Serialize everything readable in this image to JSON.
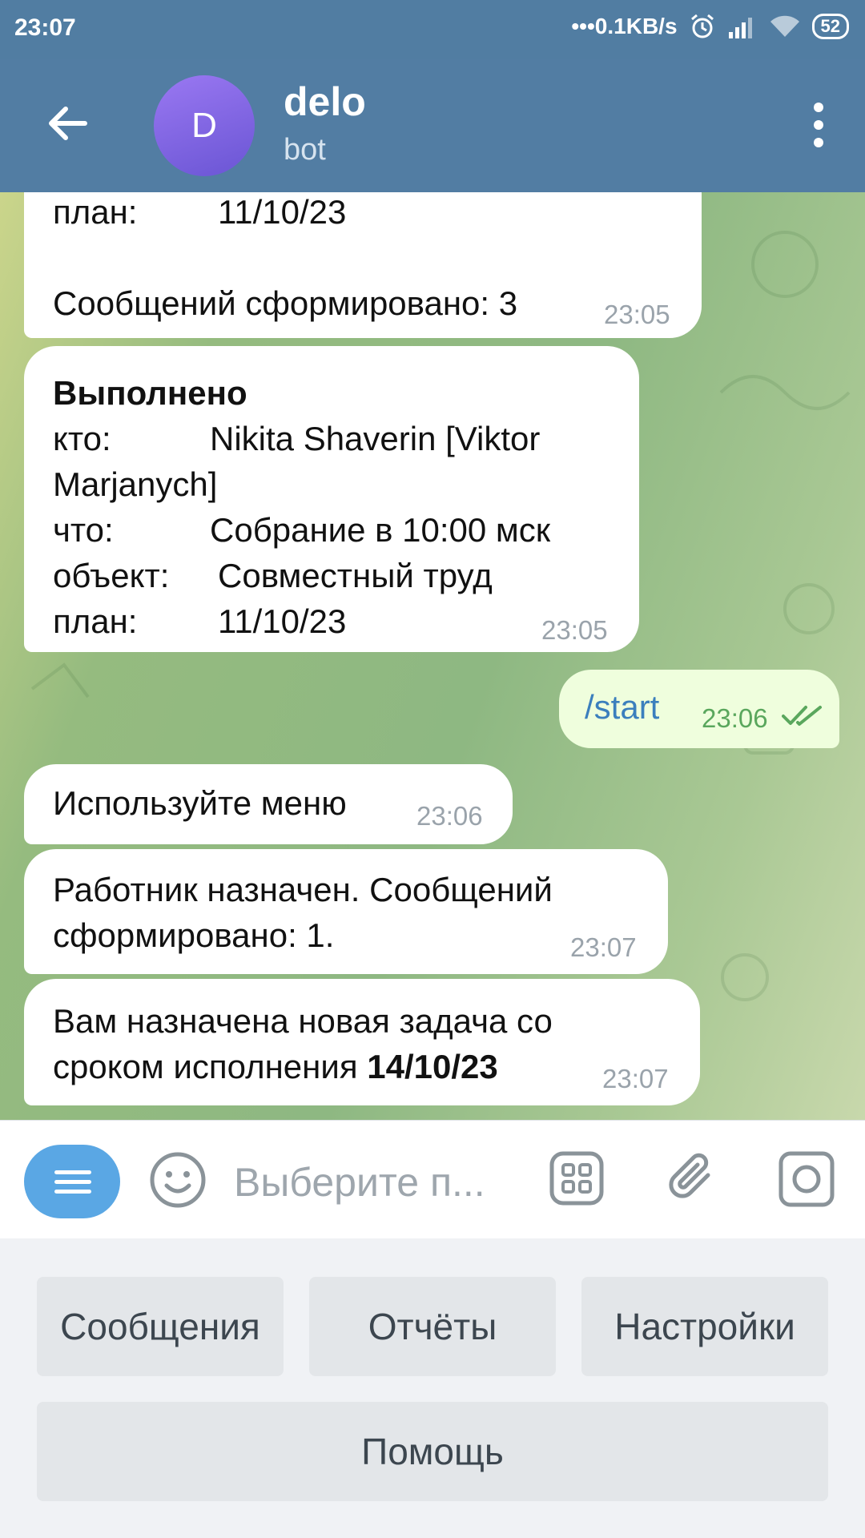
{
  "status_bar": {
    "time": "23:07",
    "net_speed": "0.1KB/s",
    "battery": "52"
  },
  "header": {
    "avatar_letter": "D",
    "title": "delo",
    "subtitle": "bot"
  },
  "messages": [
    {
      "direction": "incoming",
      "lines": [
        {
          "label": "план:",
          "value": "11/10/23"
        },
        {
          "label": "",
          "value": ""
        },
        {
          "label": "Сообщений сформировано: 3",
          "value": ""
        }
      ],
      "time": "23:05"
    },
    {
      "direction": "incoming",
      "heading": "Выполнено",
      "lines": [
        {
          "label": "кто:",
          "value": "Nikita Shaverin [Viktor"
        },
        {
          "label": "Marjanych]",
          "value": ""
        },
        {
          "label": "что:",
          "value": "Собрание в 10:00 мск"
        },
        {
          "label": "объект:",
          "value": "Совместный труд"
        },
        {
          "label": "план:",
          "value": "11/10/23"
        }
      ],
      "time": "23:05"
    },
    {
      "direction": "outgoing",
      "text": "/start",
      "time": "23:06",
      "status": "read"
    },
    {
      "direction": "incoming",
      "text": "Используйте меню",
      "time": "23:06"
    },
    {
      "direction": "incoming",
      "line1": "Работник назначен. Сообщений",
      "line2": "сформировано: 1.",
      "time": "23:07"
    },
    {
      "direction": "incoming",
      "line1": "Вам назначена новая задача со",
      "line2_prefix": "сроком исполнения ",
      "line2_bold": "14/10/23",
      "time": "23:07"
    }
  ],
  "input": {
    "placeholder": "Выберите п..."
  },
  "keyboard": {
    "buttons": [
      "Сообщения",
      "Отчёты",
      "Настройки",
      "Помощь"
    ]
  },
  "colors": {
    "header": "#527da3",
    "menu_button": "#5aa7e4",
    "outgoing_bubble": "#effedd",
    "read_check": "#5aa75d"
  }
}
